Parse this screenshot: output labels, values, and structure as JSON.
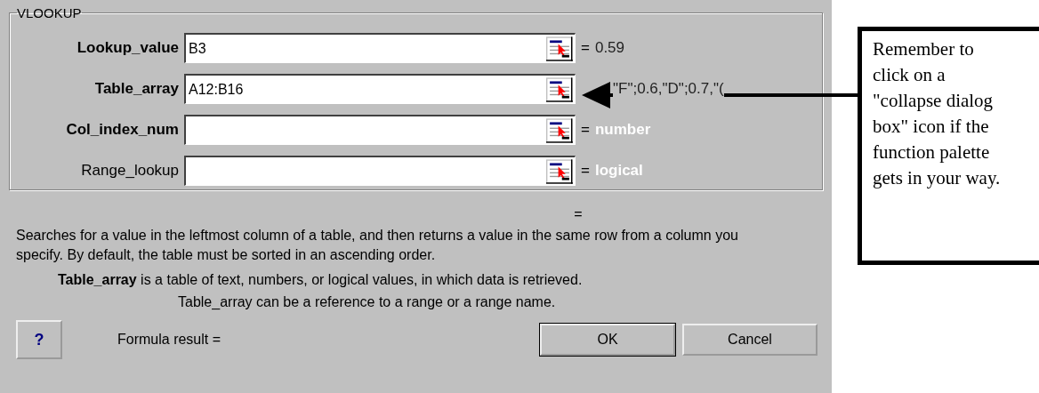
{
  "group": {
    "title": "VLOOKUP"
  },
  "arguments": [
    {
      "label": "Lookup_value",
      "required": true,
      "value": "B3",
      "equals": "=",
      "result": "0.59",
      "hint": false
    },
    {
      "label": "Table_array",
      "required": true,
      "value": "A12:B16",
      "result": "\"F\";0.6,\"D\";0.7,\"(",
      "hint": false
    },
    {
      "label": "Col_index_num",
      "required": true,
      "equals": "=",
      "result": "number",
      "hint": true
    },
    {
      "label": "Range_lookup",
      "required": false,
      "equals": "=",
      "result": "logical",
      "hint": true
    }
  ],
  "formula_equals": "=",
  "description": "Searches for a value in the leftmost column of a table, and then returns a value in the same row from a column you specify. By default, the table must be sorted in an ascending order.",
  "argument_help": "**Table_array** is a table of text, numbers, or logical values, in which data is retrieved.",
  "argument_help_2": "Table_array can be a reference to a range or a range name.",
  "help_button": "?",
  "formula_result": "Formula result =",
  "buttons": [
    "OK",
    "Cancel"
  ],
  "callout": "Remember to click on a \"collapse dialog box\" icon if the function palette gets in your way."
}
